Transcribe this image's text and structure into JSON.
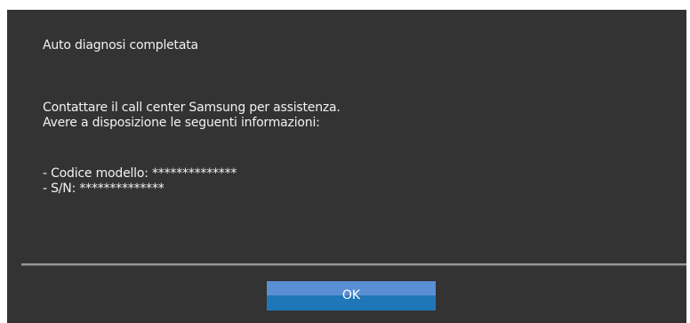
{
  "dialog": {
    "title": "Auto diagnosi completata",
    "message_lines": [
      "Contattare il call center Samsung per assistenza.",
      "Avere a disposizione le seguenti informazioni:"
    ],
    "info_lines": [
      "- Codice modello: **************",
      "- S/N: **************"
    ],
    "ok_label": "OK"
  },
  "colors": {
    "background": "#333333",
    "text": "#f2f2f2",
    "button_top": "#5b8fd4",
    "button_bottom": "#1f77b7"
  }
}
